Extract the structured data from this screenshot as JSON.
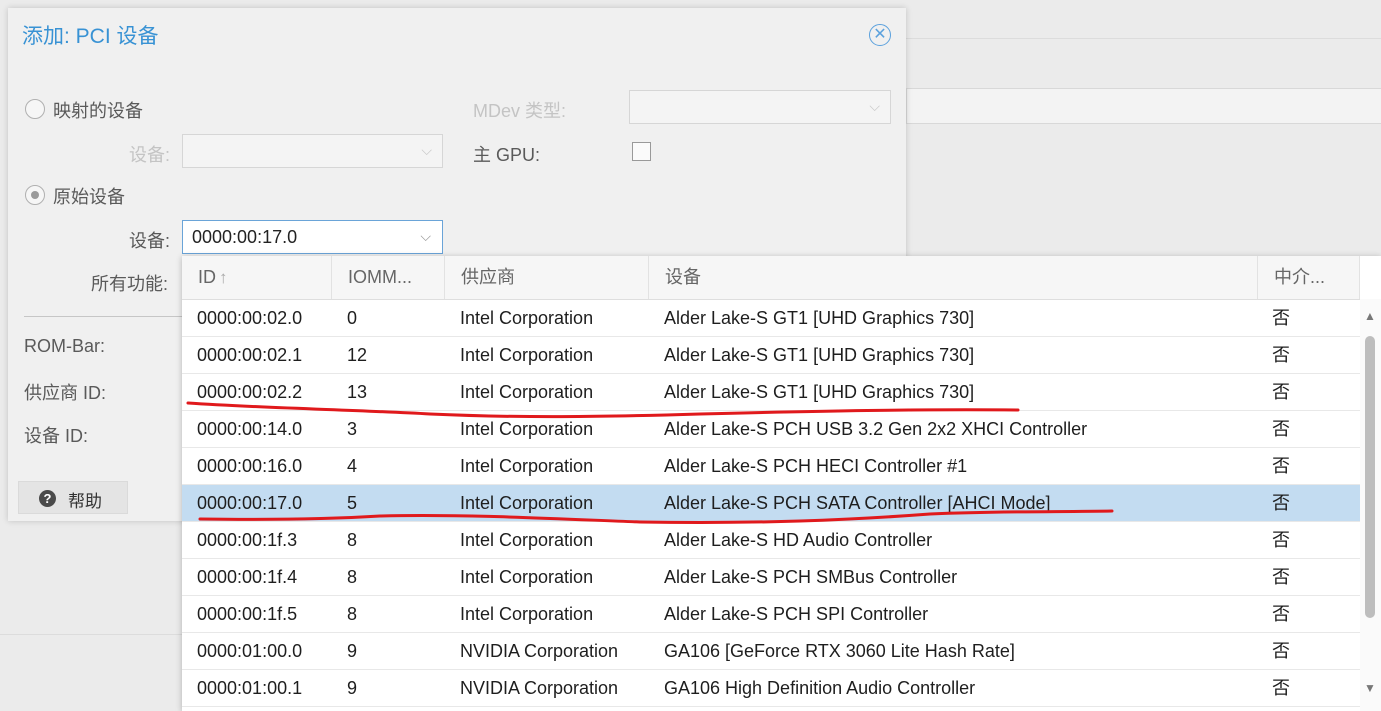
{
  "dialog": {
    "title": "添加: PCI 设备",
    "close_icon": "close-icon",
    "mapped_device_label": "映射的设备",
    "device_label_disabled": "设备:",
    "mdev_type_label": "MDev 类型:",
    "primary_gpu_label": "主 GPU:",
    "raw_device_label": "原始设备",
    "device_label": "设备:",
    "device_value": "0000:00:17.0",
    "all_functions_label": "所有功能:",
    "rom_bar_label": "ROM-Bar:",
    "vendor_id_label": "供应商 ID:",
    "device_id_label": "设备 ID:",
    "help_label": "帮助"
  },
  "grid": {
    "columns": [
      "ID",
      "IOMM...",
      "供应商",
      "设备",
      "中介..."
    ],
    "sort_icon": "↑",
    "rows": [
      {
        "id": "0000:00:02.0",
        "iommu": "0",
        "vendor": "Intel Corporation",
        "device": "Alder Lake-S GT1 [UHD Graphics 730]",
        "mdev": "否"
      },
      {
        "id": "0000:00:02.1",
        "iommu": "12",
        "vendor": "Intel Corporation",
        "device": "Alder Lake-S GT1 [UHD Graphics 730]",
        "mdev": "否"
      },
      {
        "id": "0000:00:02.2",
        "iommu": "13",
        "vendor": "Intel Corporation",
        "device": "Alder Lake-S GT1 [UHD Graphics 730]",
        "mdev": "否"
      },
      {
        "id": "0000:00:14.0",
        "iommu": "3",
        "vendor": "Intel Corporation",
        "device": "Alder Lake-S PCH USB 3.2 Gen 2x2 XHCI Controller",
        "mdev": "否"
      },
      {
        "id": "0000:00:16.0",
        "iommu": "4",
        "vendor": "Intel Corporation",
        "device": "Alder Lake-S PCH HECI Controller #1",
        "mdev": "否"
      },
      {
        "id": "0000:00:17.0",
        "iommu": "5",
        "vendor": "Intel Corporation",
        "device": "Alder Lake-S PCH SATA Controller [AHCI Mode]",
        "mdev": "否"
      },
      {
        "id": "0000:00:1f.3",
        "iommu": "8",
        "vendor": "Intel Corporation",
        "device": "Alder Lake-S HD Audio Controller",
        "mdev": "否"
      },
      {
        "id": "0000:00:1f.4",
        "iommu": "8",
        "vendor": "Intel Corporation",
        "device": "Alder Lake-S PCH SMBus Controller",
        "mdev": "否"
      },
      {
        "id": "0000:00:1f.5",
        "iommu": "8",
        "vendor": "Intel Corporation",
        "device": "Alder Lake-S PCH SPI Controller",
        "mdev": "否"
      },
      {
        "id": "0000:01:00.0",
        "iommu": "9",
        "vendor": "NVIDIA Corporation",
        "device": "GA106 [GeForce RTX 3060 Lite Hash Rate]",
        "mdev": "否"
      },
      {
        "id": "0000:01:00.1",
        "iommu": "9",
        "vendor": "NVIDIA Corporation",
        "device": "GA106 High Definition Audio Controller",
        "mdev": "否"
      }
    ]
  },
  "colors": {
    "title": "#3892d4",
    "selected_row": "#c3dcf1",
    "annotation": "#e0191c"
  }
}
